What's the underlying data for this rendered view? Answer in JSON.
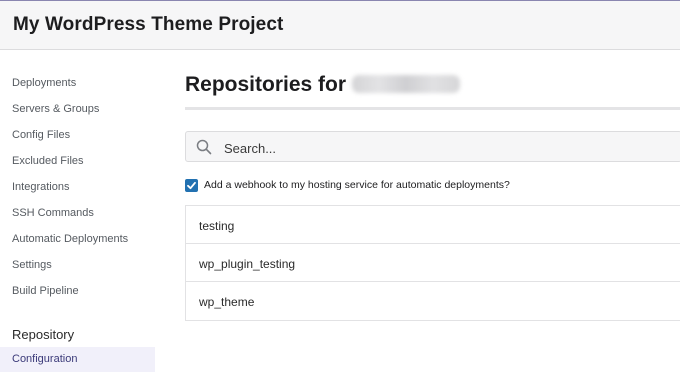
{
  "header": {
    "title": "My WordPress Theme Project"
  },
  "sidebar": {
    "items": [
      {
        "label": "Deployments"
      },
      {
        "label": "Servers & Groups"
      },
      {
        "label": "Config Files"
      },
      {
        "label": "Excluded Files"
      },
      {
        "label": "Integrations"
      },
      {
        "label": "SSH Commands"
      },
      {
        "label": "Automatic Deployments"
      },
      {
        "label": "Settings"
      },
      {
        "label": "Build Pipeline"
      }
    ],
    "section_label": "Repository",
    "active_item": "Configuration"
  },
  "main": {
    "title": "Repositories for",
    "search_placeholder": "Search...",
    "webhook_label": "Add a webhook to my hosting service for automatic deployments?",
    "webhook_checked": true,
    "repositories": [
      {
        "name": "testing"
      },
      {
        "name": "wp_plugin_testing"
      },
      {
        "name": "wp_theme"
      }
    ]
  },
  "colors": {
    "accent": "#2271b1",
    "active_nav_bg": "#f1f0fa",
    "active_nav_text": "#3b3a79"
  }
}
